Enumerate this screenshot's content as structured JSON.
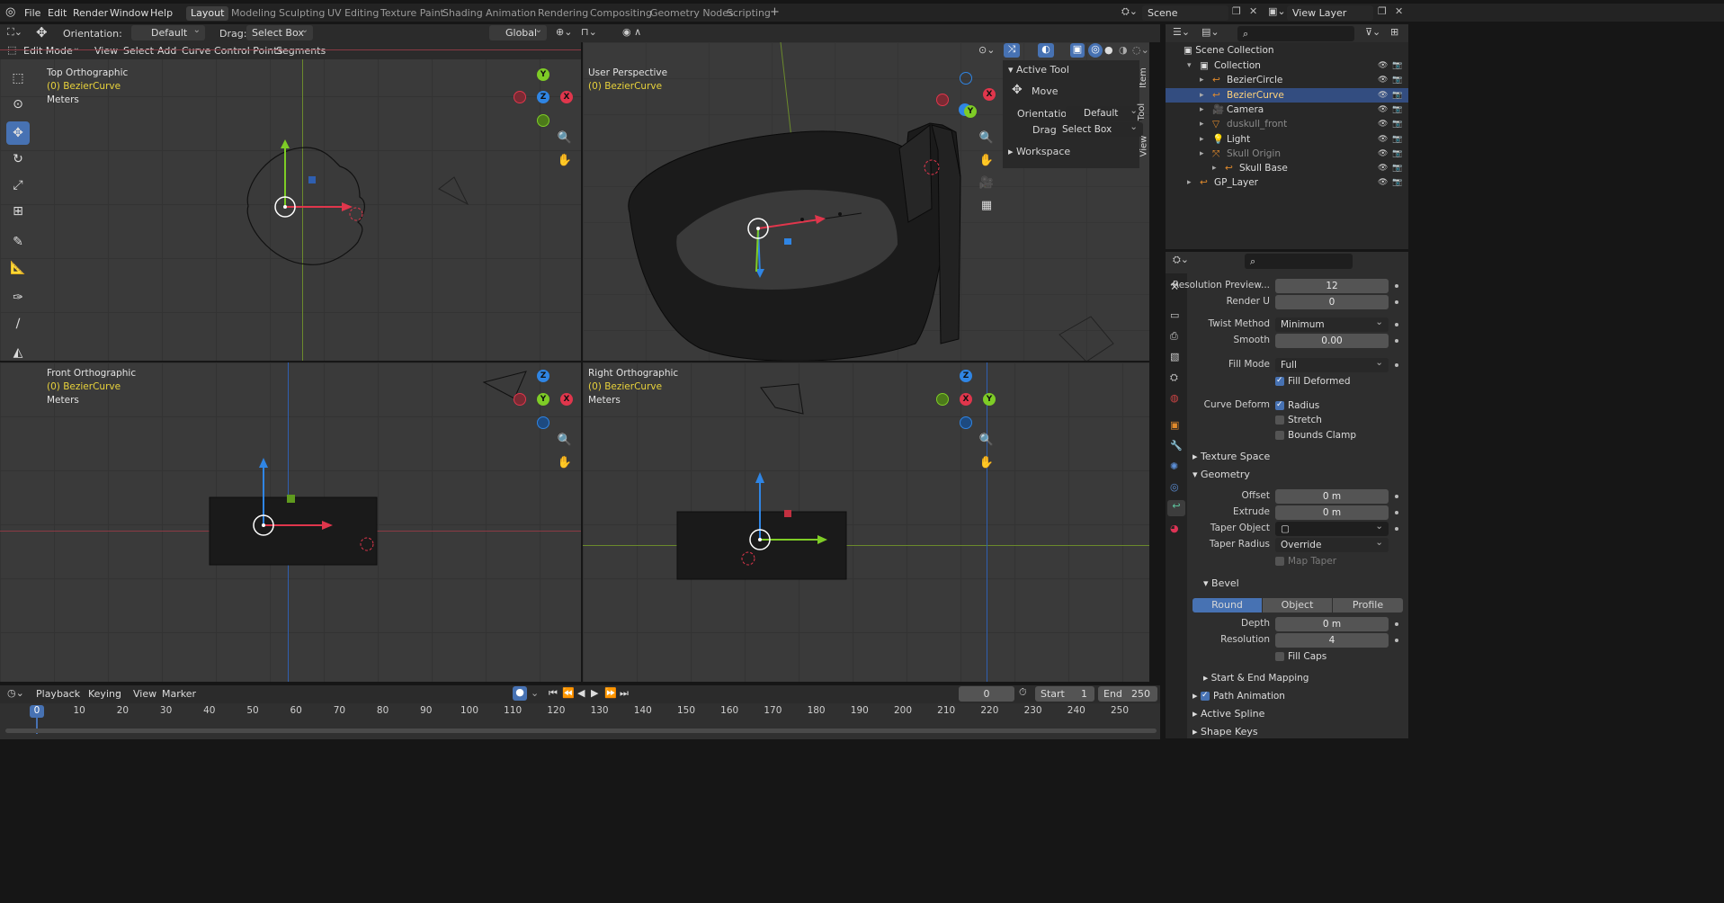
{
  "topbar": {
    "menus": [
      "File",
      "Edit",
      "Render",
      "Window",
      "Help"
    ],
    "workspaces": [
      "Layout",
      "Modeling",
      "Sculpting",
      "UV Editing",
      "Texture Paint",
      "Shading",
      "Animation",
      "Rendering",
      "Compositing",
      "Geometry Nodes",
      "Scripting"
    ],
    "active_workspace": "Layout",
    "scene": "Scene",
    "view_layer": "View Layer"
  },
  "viewport_header": {
    "mode": "Edit Mode",
    "orientation_label": "Orientation:",
    "orientation_value": "Default",
    "drag_label": "Drag:",
    "drag_value": "Select Box",
    "transform_orientation": "Global",
    "menus": [
      "View",
      "Select",
      "Add",
      "Curve",
      "Control Points",
      "Segments"
    ]
  },
  "viewports": {
    "top": {
      "title": "Top Orthographic",
      "object": "(0) BezierCurve",
      "units": "Meters"
    },
    "persp": {
      "title": "User Perspective",
      "object": "(0) BezierCurve"
    },
    "front": {
      "title": "Front Orthographic",
      "object": "(0) BezierCurve",
      "units": "Meters"
    },
    "right": {
      "title": "Right Orthographic",
      "object": "(0) BezierCurve",
      "units": "Meters"
    }
  },
  "npanel": {
    "active_tool_header": "Active Tool",
    "tool": "Move",
    "orientation_label": "Orientation",
    "orientation_value": "Default",
    "drag_label": "Drag:",
    "drag_value": "Select Box",
    "workspace_header": "Workspace",
    "tabs": [
      "Item",
      "Tool",
      "View"
    ]
  },
  "outliner": {
    "scene_collection": "Scene Collection",
    "items": [
      {
        "name": "Collection",
        "indent": 1
      },
      {
        "name": "BezierCircle",
        "indent": 2
      },
      {
        "name": "BezierCurve",
        "indent": 2,
        "selected": true
      },
      {
        "name": "Camera",
        "indent": 2
      },
      {
        "name": "duskull_front",
        "indent": 2,
        "dim": true
      },
      {
        "name": "Light",
        "indent": 2
      },
      {
        "name": "Skull Origin",
        "indent": 2,
        "dim": true
      },
      {
        "name": "Skull Base",
        "indent": 3
      },
      {
        "name": "GP_Layer",
        "indent": 1
      }
    ]
  },
  "properties": {
    "resolution_preview_label": "Resolution Preview...",
    "resolution_preview": "12",
    "render_u_label": "Render U",
    "render_u": "0",
    "twist_method_label": "Twist Method",
    "twist_method": "Minimum",
    "smooth_label": "Smooth",
    "smooth": "0.00",
    "fill_mode_label": "Fill Mode",
    "fill_mode": "Full",
    "fill_deformed": "Fill Deformed",
    "curve_deform_label": "Curve Deform",
    "radius": "Radius",
    "stretch": "Stretch",
    "bounds_clamp": "Bounds Clamp",
    "texture_space": "Texture Space",
    "geometry": "Geometry",
    "offset_label": "Offset",
    "offset": "0 m",
    "extrude_label": "Extrude",
    "extrude": "0 m",
    "taper_object_label": "Taper Object",
    "taper_radius_label": "Taper Radius",
    "taper_radius": "Override",
    "map_taper": "Map Taper",
    "bevel": "Bevel",
    "bevel_modes": [
      "Round",
      "Object",
      "Profile"
    ],
    "depth_label": "Depth",
    "depth": "0 m",
    "resolution_label": "Resolution",
    "resolution": "4",
    "fill_caps": "Fill Caps",
    "start_end_mapping": "Start & End Mapping",
    "path_animation": "Path Animation",
    "active_spline": "Active Spline",
    "shape_keys": "Shape Keys"
  },
  "timeline": {
    "menus": [
      "Playback",
      "Keying",
      "View",
      "Marker"
    ],
    "current_frame": "0",
    "start_label": "Start",
    "start": "1",
    "end_label": "End",
    "end": "250",
    "ticks": [
      "0",
      "10",
      "20",
      "30",
      "40",
      "50",
      "60",
      "70",
      "80",
      "90",
      "100",
      "110",
      "120",
      "130",
      "140",
      "150",
      "160",
      "170",
      "180",
      "190",
      "200",
      "210",
      "220",
      "230",
      "240",
      "250"
    ]
  },
  "colors": {
    "accent": "#4772b3",
    "x_axis": "#e0364c",
    "y_axis": "#7ecc26",
    "z_axis": "#2f85e4",
    "object_yellow": "#e8d23b"
  }
}
